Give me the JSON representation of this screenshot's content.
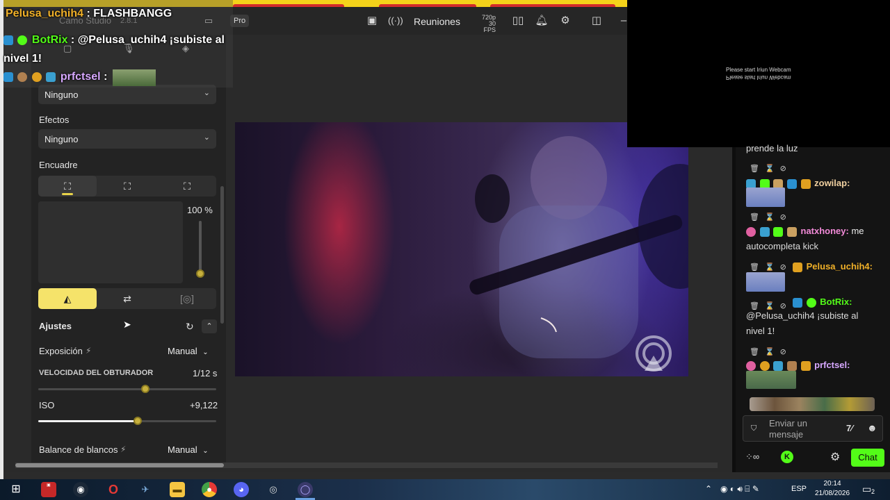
{
  "window": {
    "app_name": "Camo Studio",
    "version": "2.8.1",
    "pro_label": "Pro",
    "meetings_label": "Reuniones",
    "resolution": "720p",
    "fps": "30 FPS"
  },
  "panel": {
    "top_select": "Ninguno",
    "effects_label": "Efectos",
    "effects_select": "Ninguno",
    "framing_label": "Encuadre",
    "zoom_value": "100 %",
    "adjust_label": "Ajustes",
    "exposure_label": "Exposición",
    "exposure_mode": "Manual",
    "shutter_label": "VELOCIDAD DEL OBTURADOR",
    "shutter_value": "1/12 s",
    "shutter_level": 0.6,
    "iso_label": "ISO",
    "iso_value": "+9,122",
    "iso_level": 0.56,
    "wb_label": "Balance de blancos",
    "wb_mode": "Manual"
  },
  "overlay": {
    "line1_user": "Pelusa_uchih4",
    "line1_msg": ": FLASHBANGG",
    "line2_user": "BotRix",
    "line2_msg": ": @Pelusa_uchih4 ¡subiste al",
    "line2_msg2": "nivel 1!",
    "line3_user": "prfctsel",
    "line3_sep": ":"
  },
  "webcam": {
    "text1": "Please start Iriun Webcam",
    "text2": "Please start Iriun Webcam"
  },
  "chat": {
    "partial_msg": "prende la luz",
    "msg1_user": "zowilap:",
    "msg2_user": "natxhoney:",
    "msg2_text1": "me",
    "msg2_text2": "autocompleta kick",
    "msg3_user": "Pelusa_uchih4:",
    "msg4_user": "BotRix:",
    "msg4_text1": "@Pelusa_uchih4 ¡subiste al",
    "msg4_text2": "nivel 1!",
    "msg5_user": "prfctsel:",
    "input_placeholder1": "Enviar un",
    "input_placeholder2": "mensaje",
    "chat_button": "Chat"
  },
  "taskbar": {
    "lang": "ESP",
    "time": "20:14",
    "date": "21/08/2026",
    "notif_count": "2"
  },
  "colors": {
    "accent_yellow": "#f5e36a",
    "kick_green": "#53fc18",
    "botrix_green": "#53fc18",
    "pelusa_orange": "#f0b028",
    "prfctsel_purple": "#d7a8ff"
  }
}
